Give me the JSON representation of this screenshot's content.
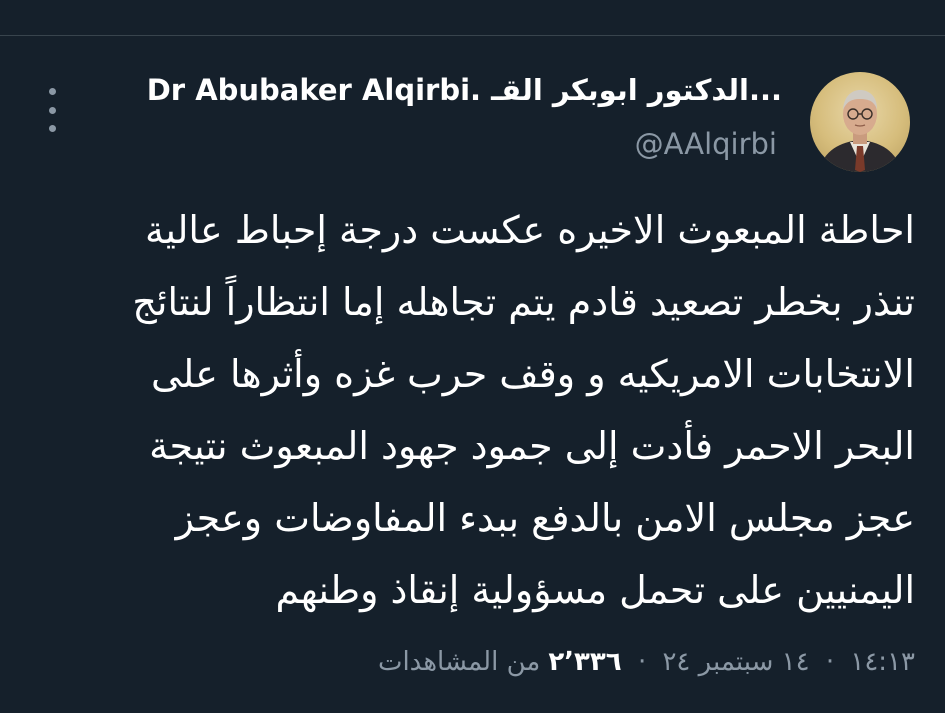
{
  "tweet": {
    "author": {
      "display_name": "Dr Abubaker Alqirbi. الدكتور ابوبكر القـ...",
      "handle": "@AAlqirbi"
    },
    "text_lines": [
      "احاطة المبعوث الاخيره عكست درجة إحباط عالية",
      "تنذر بخطر تصعيد قادم يتم تجاهله  إما انتظاراً لنتائج",
      "الانتخابات الامريكيه و وقف حرب غزه وأثرها على",
      "البحر الاحمر فأدت إلى جمود جهود المبعوث نتيجة",
      "عجز مجلس الامن بالدفع  ببدء المفاوضات وعجز",
      "اليمنيين على تحمل مسؤولية إنقاذ وطنهم"
    ],
    "meta": {
      "time": "١٤:١٣",
      "separator": "·",
      "date": "١٤ سبتمبر ٢٤",
      "views_count": "٢٬٣٣٦",
      "views_label": "من المشاهدات"
    },
    "icons": {
      "more": "more-vertical-icon"
    }
  },
  "colors": {
    "background": "#15202b",
    "text_primary": "#ffffff",
    "text_secondary": "#8b98a5",
    "divider": "#38444d"
  }
}
